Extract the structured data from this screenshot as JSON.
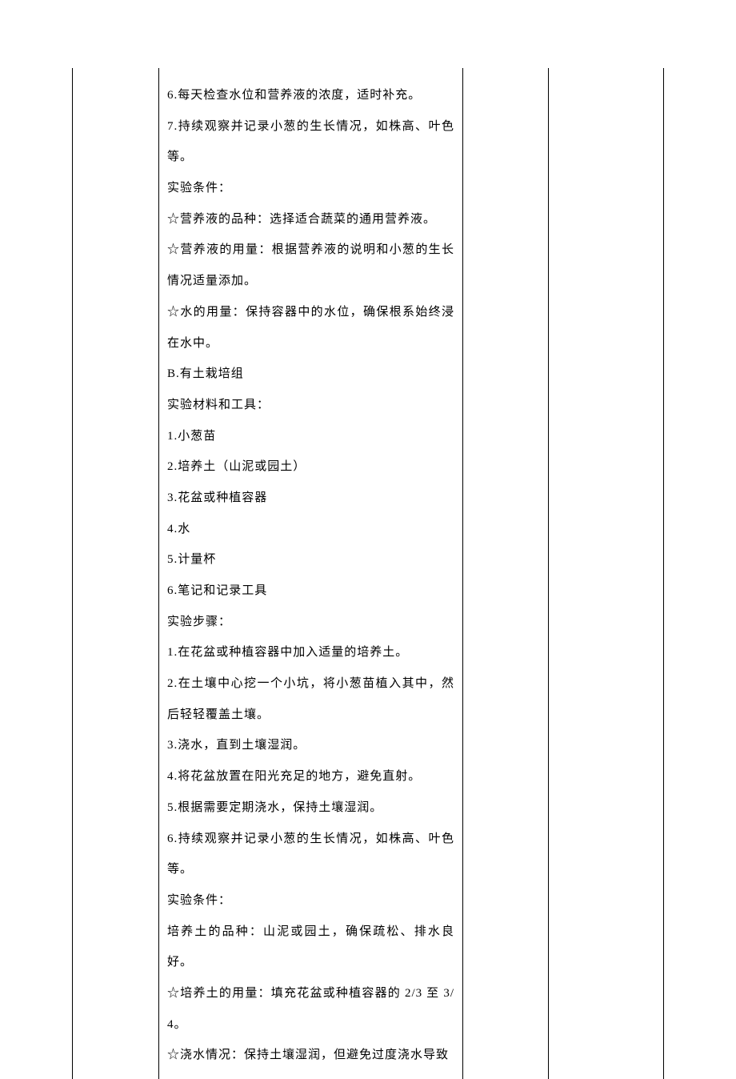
{
  "lines": [
    "6.每天检查水位和营养液的浓度，适时补充。",
    "7.持续观察并记录小葱的生长情况，如株高、叶色等。",
    "实验条件：",
    "☆营养液的品种：选择适合蔬菜的通用营养液。",
    "☆营养液的用量：根据营养液的说明和小葱的生长情况适量添加。",
    "☆水的用量：保持容器中的水位，确保根系始终浸在水中。",
    "B.有土栽培组",
    "实验材料和工具：",
    "1.小葱苗",
    "2.培养土（山泥或园土）",
    "3.花盆或种植容器",
    "4.水",
    "5.计量杯",
    "6.笔记和记录工具",
    "实验步骤：",
    "1.在花盆或种植容器中加入适量的培养土。",
    "2.在土壤中心挖一个小坑，将小葱苗植入其中，然后轻轻覆盖土壤。",
    "3.浇水，直到土壤湿润。",
    "4.将花盆放置在阳光充足的地方，避免直射。",
    "5.根据需要定期浇水，保持土壤湿润。",
    "6.持续观察并记录小葱的生长情况，如株高、叶色等。",
    "实验条件：",
    "培养土的品种：山泥或园土，确保疏松、排水良好。",
    "☆培养土的用量：填充花盆或种植容器的 2/3 至 3/4。",
    "☆浇水情况：保持土壤湿润，但避免过度浇水导致"
  ]
}
